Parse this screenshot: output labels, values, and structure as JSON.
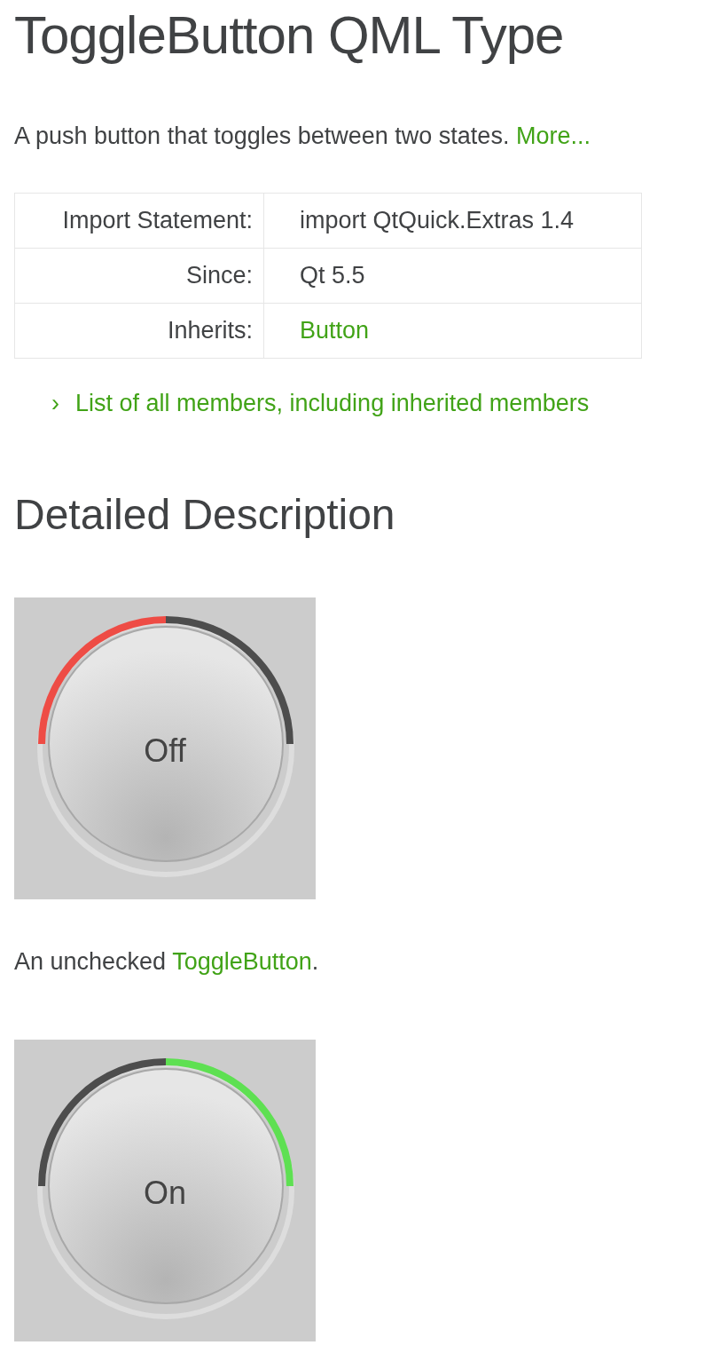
{
  "title": "ToggleButton QML Type",
  "brief": {
    "text": "A push button that toggles between two states.",
    "link": "More..."
  },
  "properties_table": {
    "rows": [
      {
        "label": "Import Statement:",
        "value": "import QtQuick.Extras 1.4",
        "is_link": false
      },
      {
        "label": "Since:",
        "value": "Qt 5.5",
        "is_link": false
      },
      {
        "label": "Inherits:",
        "value": "Button",
        "is_link": true
      }
    ]
  },
  "members_link": {
    "bullet": "›",
    "text": "List of all members, including inherited members"
  },
  "section_heading": "Detailed Description",
  "figures": [
    {
      "button_label": "Off",
      "checked": false,
      "caption": {
        "before": "An unchecked ",
        "link": "ToggleButton",
        "after": "."
      }
    },
    {
      "button_label": "On",
      "checked": true
    }
  ]
}
